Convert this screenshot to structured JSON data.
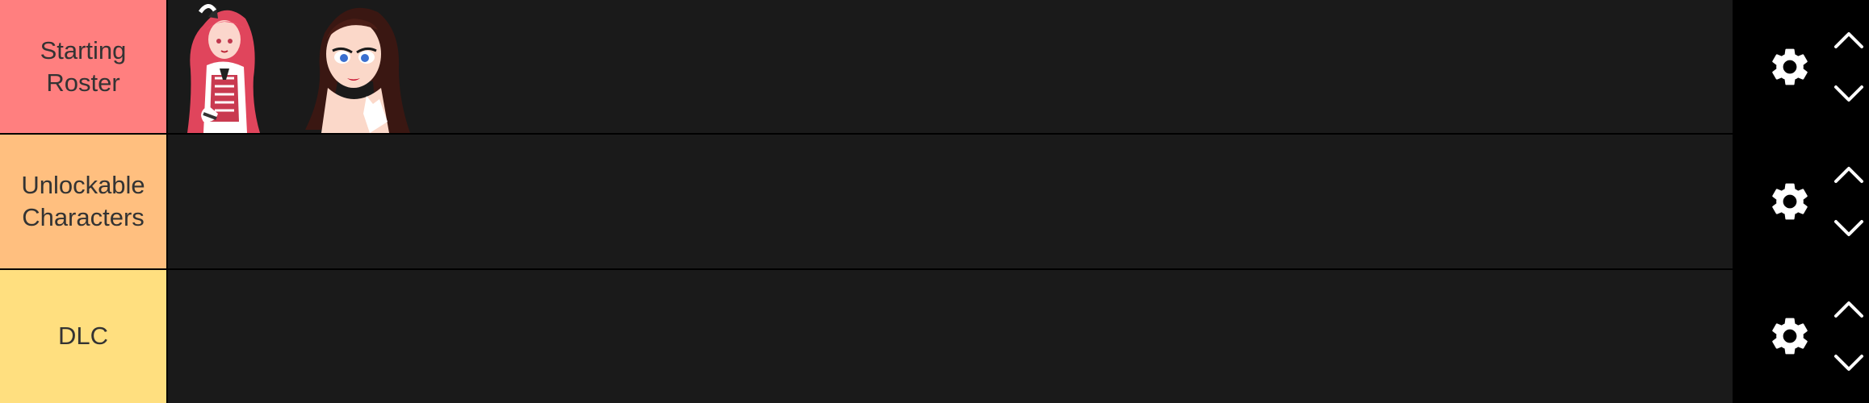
{
  "tiers": [
    {
      "label": "Starting Roster",
      "color": "#ff7f7f",
      "items": [
        {
          "name": "character-pink-hair-girl"
        },
        {
          "name": "character-brown-hair-woman"
        }
      ]
    },
    {
      "label": "Unlockable Characters",
      "color": "#ffbf7f",
      "items": []
    },
    {
      "label": "DLC",
      "color": "#ffdf7f",
      "items": []
    }
  ],
  "controls": {
    "settings_icon": "gear-icon",
    "move_up_icon": "chevron-up-icon",
    "move_down_icon": "chevron-down-icon"
  }
}
